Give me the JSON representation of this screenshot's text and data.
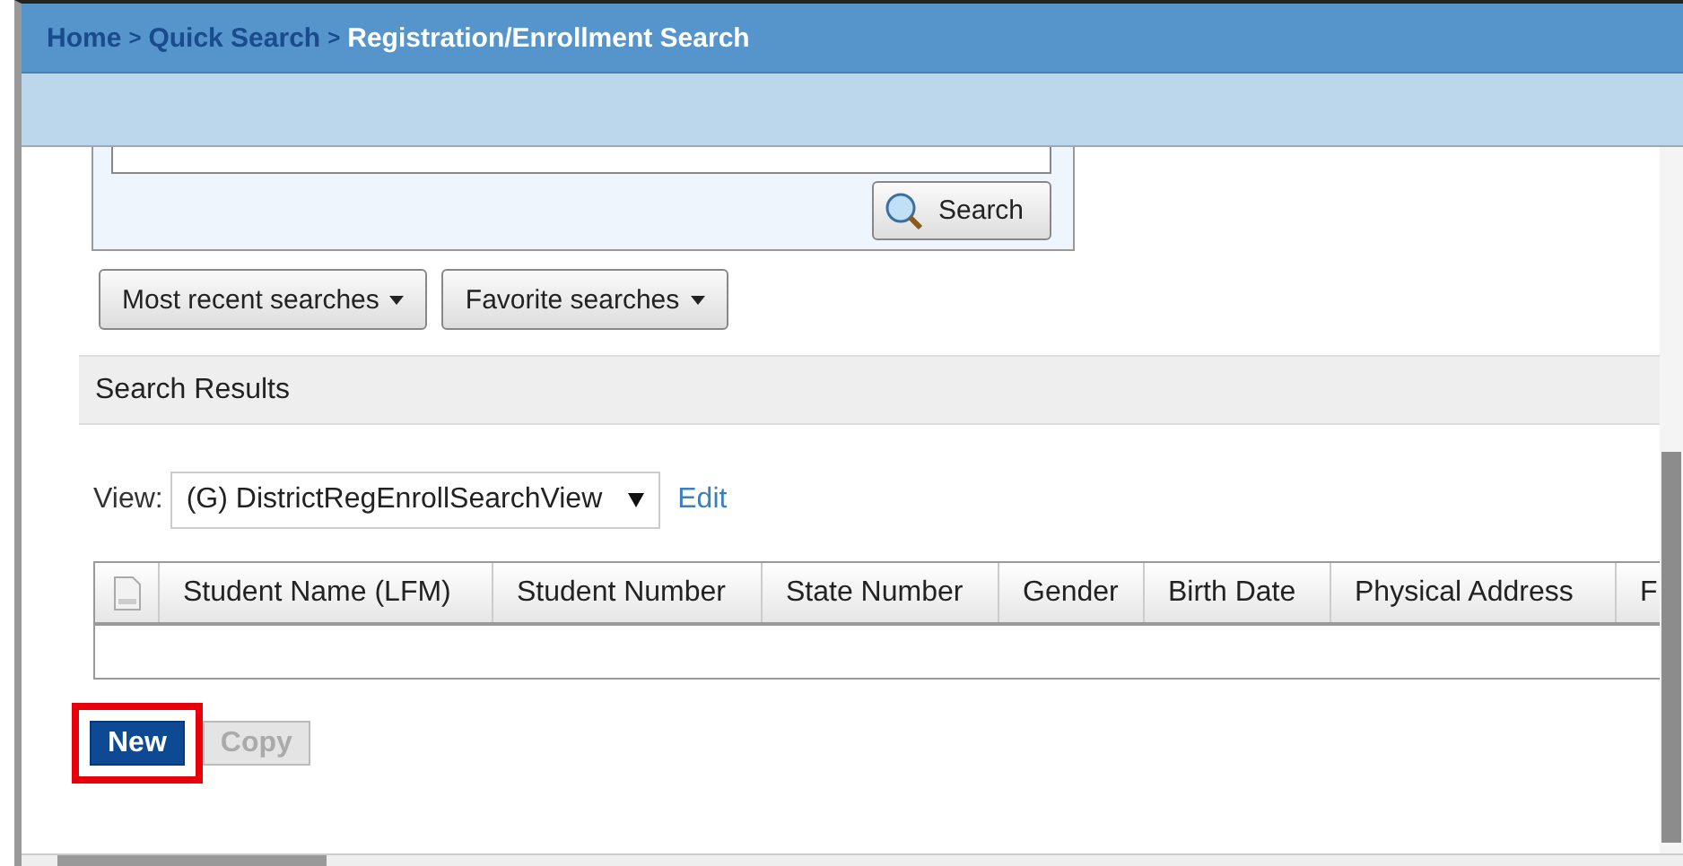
{
  "breadcrumb": [
    {
      "label": "Home",
      "kind": "link"
    },
    {
      "label": ">",
      "kind": "separator"
    },
    {
      "label": "Quick Search",
      "kind": "link"
    },
    {
      "label": ">",
      "kind": "separator"
    },
    {
      "label": "Registration/Enrollment Search",
      "kind": "current"
    }
  ],
  "search_button": "Search",
  "search_menus": [
    {
      "label": "Most recent searches"
    },
    {
      "label": "Favorite searches"
    }
  ],
  "results_title": "Search Results",
  "view": {
    "label": "View:",
    "value": "(G) DistrictRegEnrollSearchView",
    "edit": "Edit"
  },
  "table": {
    "columns": [
      "Student Name (LFM)",
      "Student Number",
      "State Number",
      "Gender",
      "Birth Date",
      "Physical Address",
      "F"
    ]
  },
  "actions": [
    {
      "label": "New",
      "disabled": false,
      "highlighted": true
    },
    {
      "label": "Copy",
      "disabled": true,
      "highlighted": false
    }
  ]
}
